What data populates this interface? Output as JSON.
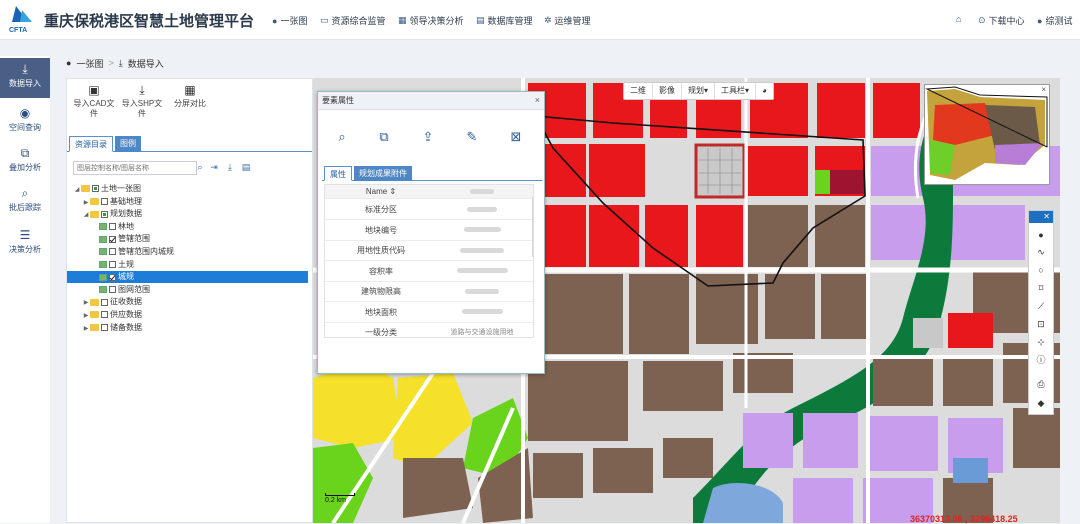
{
  "header": {
    "title": "重庆保税港区智慧土地管理平台",
    "logo_text": "CFTA",
    "nav": [
      {
        "label": "一张图",
        "icon": "map-pin-icon"
      },
      {
        "label": "资源综合监管",
        "icon": "monitor-icon"
      },
      {
        "label": "领导决策分析",
        "icon": "chart-icon"
      },
      {
        "label": "数据库管理",
        "icon": "database-icon"
      },
      {
        "label": "运维管理",
        "icon": "gear-icon"
      }
    ],
    "right": {
      "download": "下载中心",
      "user": "综测试"
    }
  },
  "rail": [
    {
      "label": "数据导入",
      "icon": "import-icon",
      "active": true
    },
    {
      "label": "空间查询",
      "icon": "location-icon"
    },
    {
      "label": "叠加分析",
      "icon": "overlay-icon"
    },
    {
      "label": "批后跟踪",
      "icon": "search-icon"
    },
    {
      "label": "决策分析",
      "icon": "list-icon"
    }
  ],
  "breadcrumb": {
    "root": "一张图",
    "current": "数据导入"
  },
  "panel": {
    "tools": [
      {
        "label": "导入CAD文件",
        "icon": "cad-file-icon"
      },
      {
        "label": "导入SHP文件",
        "icon": "shp-file-icon"
      },
      {
        "label": "分屏对比",
        "icon": "split-screen-icon"
      }
    ],
    "tabs": [
      "资源目录",
      "图例"
    ],
    "search_placeholder": "图层控制名称/图层名称",
    "tree": [
      {
        "label": "土地一张图",
        "level": 0,
        "type": "folder",
        "check": "part",
        "exp": true
      },
      {
        "label": "基础地理",
        "level": 1,
        "type": "folder",
        "check": "off",
        "exp": false
      },
      {
        "label": "规划数据",
        "level": 1,
        "type": "folder",
        "check": "part",
        "exp": true
      },
      {
        "label": "林地",
        "level": 2,
        "type": "layer",
        "check": "off"
      },
      {
        "label": "管辖范围",
        "level": 2,
        "type": "layer",
        "check": "on"
      },
      {
        "label": "管辖范围内城规",
        "level": 2,
        "type": "layer",
        "check": "off"
      },
      {
        "label": "土规",
        "level": 2,
        "type": "layer",
        "check": "off"
      },
      {
        "label": "城规",
        "level": 2,
        "type": "layer",
        "check": "on",
        "selected": true
      },
      {
        "label": "图网范围",
        "level": 2,
        "type": "layer",
        "check": "off"
      },
      {
        "label": "征收数据",
        "level": 1,
        "type": "folder",
        "check": "off",
        "exp": false
      },
      {
        "label": "供应数据",
        "level": 1,
        "type": "folder",
        "check": "off",
        "exp": false
      },
      {
        "label": "储备数据",
        "level": 1,
        "type": "folder",
        "check": "off",
        "exp": false
      }
    ]
  },
  "map": {
    "toolbar": [
      "二维",
      "影像",
      "规划▾",
      "工具栏▾"
    ],
    "scale": "0.2 km",
    "coords": "36370313.06 , 3296418.25",
    "right_tools": [
      "point-icon",
      "line-icon",
      "circle-icon",
      "polygon-icon",
      "ruler-icon",
      "area-icon",
      "locate-icon",
      "info-icon",
      "print-icon",
      "eraser-icon"
    ]
  },
  "dialog": {
    "title": "要素属性",
    "icons": [
      "zoom-feature-icon",
      "frame-icon",
      "upload-icon",
      "edit-icon",
      "excel-icon"
    ],
    "tabs": [
      "属性",
      "规划成果附件"
    ],
    "header": "Name ⇕",
    "rows": [
      "标准分区",
      "地块编号",
      "用地性质代码",
      "容积率",
      "建筑物限高",
      "地块面积",
      "一级分类"
    ],
    "last_value": "道路与交通设施用地"
  }
}
